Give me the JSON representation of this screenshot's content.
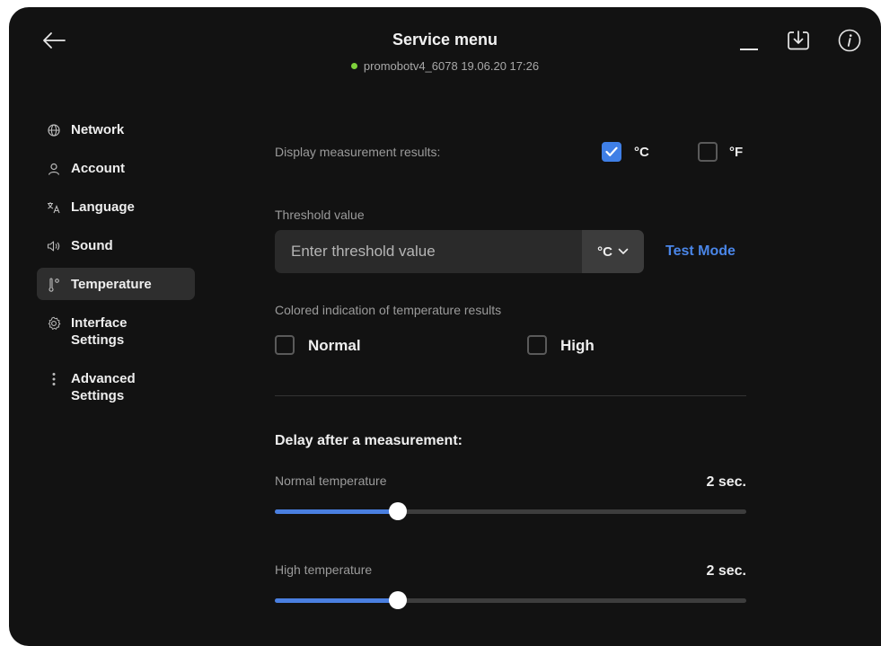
{
  "header": {
    "title": "Service menu",
    "subtitle": "promobotv4_6078 19.06.20  17:26",
    "status_color": "#7ed13b",
    "icons": [
      "back-arrow-icon",
      "minimize-icon",
      "download-icon",
      "info-icon"
    ]
  },
  "sidebar": {
    "items": [
      {
        "label": "Network",
        "icon": "globe-icon"
      },
      {
        "label": "Account",
        "icon": "user-icon"
      },
      {
        "label": "Language",
        "icon": "translate-icon"
      },
      {
        "label": "Sound",
        "icon": "speaker-icon"
      },
      {
        "label": "Temperature",
        "icon": "thermometer-icon",
        "active": true
      },
      {
        "label": "Interface\nSettings",
        "icon": "gear-icon"
      },
      {
        "label": "Advanced\nSettings",
        "icon": "vertical-dots-icon"
      }
    ]
  },
  "display": {
    "label": "Display measurement results:",
    "celsius": {
      "label": "°C",
      "checked": true
    },
    "fahrenheit": {
      "label": "°F",
      "checked": false
    }
  },
  "threshold": {
    "label": "Threshold value",
    "value": "",
    "placeholder": "Enter threshold value",
    "unit": "°C",
    "test_mode_label": "Test Mode"
  },
  "colored_indication": {
    "label": "Colored indication of temperature results",
    "normal": {
      "label": "Normal",
      "checked": false
    },
    "high": {
      "label": "High",
      "checked": false
    }
  },
  "delay": {
    "title": "Delay after a measurement:",
    "normal": {
      "label": "Normal temperature",
      "value_text": "2 sec.",
      "slider_fraction": 0.26
    },
    "high": {
      "label": "High temperature",
      "value_text": "2 sec.",
      "slider_fraction": 0.26
    }
  },
  "colors": {
    "accent": "#3f7fe6",
    "link": "#4a86e8",
    "background": "#121212"
  }
}
